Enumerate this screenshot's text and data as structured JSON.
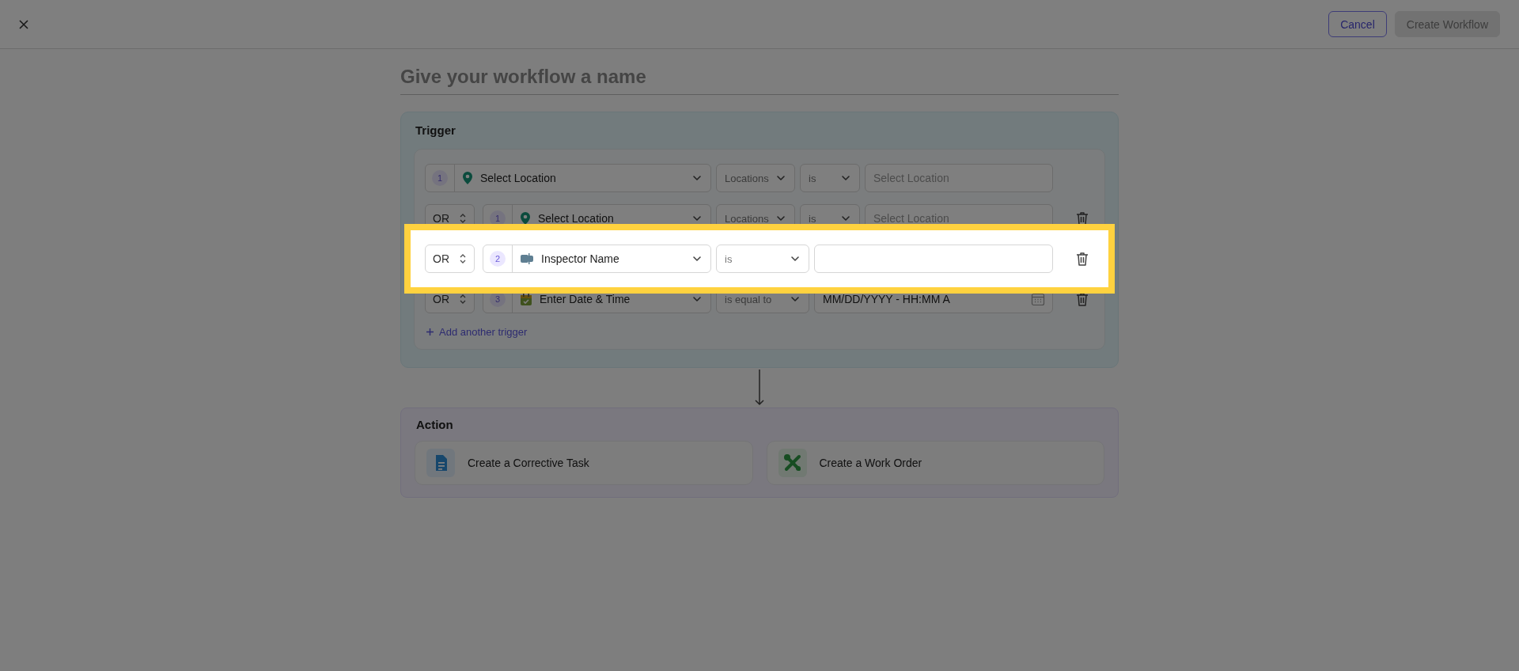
{
  "header": {
    "buttons": [
      {
        "label": "Cancel",
        "kind": "outline",
        "disabled": false
      },
      {
        "label": "Create Workflow",
        "kind": "primary",
        "disabled": true
      }
    ]
  },
  "workflow_name": {
    "placeholder": "Give your workflow a name"
  },
  "trigger": {
    "title": "Trigger",
    "add_link": "Add another trigger",
    "rows": [
      {
        "kind": "location",
        "step": "1",
        "field": "Select Location",
        "scope": "Locations",
        "operator": "is",
        "placeholder": "Select Location",
        "deletable": false,
        "highlighted": false
      },
      {
        "kind": "location",
        "connector": "OR",
        "step": "1",
        "field": "Select Location",
        "scope": "Locations",
        "operator": "is",
        "placeholder": "Select Location",
        "deletable": true,
        "highlighted": false
      },
      {
        "kind": "person",
        "connector": "OR",
        "step": "2",
        "field": "Inspector Name",
        "operator": "is",
        "deletable": true,
        "highlighted": true
      },
      {
        "kind": "date",
        "connector": "OR",
        "step": "3",
        "field": "Enter Date & Time",
        "operator": "is equal to",
        "value": "MM/DD/YYYY - HH:MM A",
        "deletable": true,
        "highlighted": false
      }
    ]
  },
  "action": {
    "title": "Action",
    "options": [
      {
        "label": "Create a Corrective Task",
        "kind": "task"
      },
      {
        "label": "Create a Work Order",
        "kind": "work_order"
      }
    ]
  }
}
